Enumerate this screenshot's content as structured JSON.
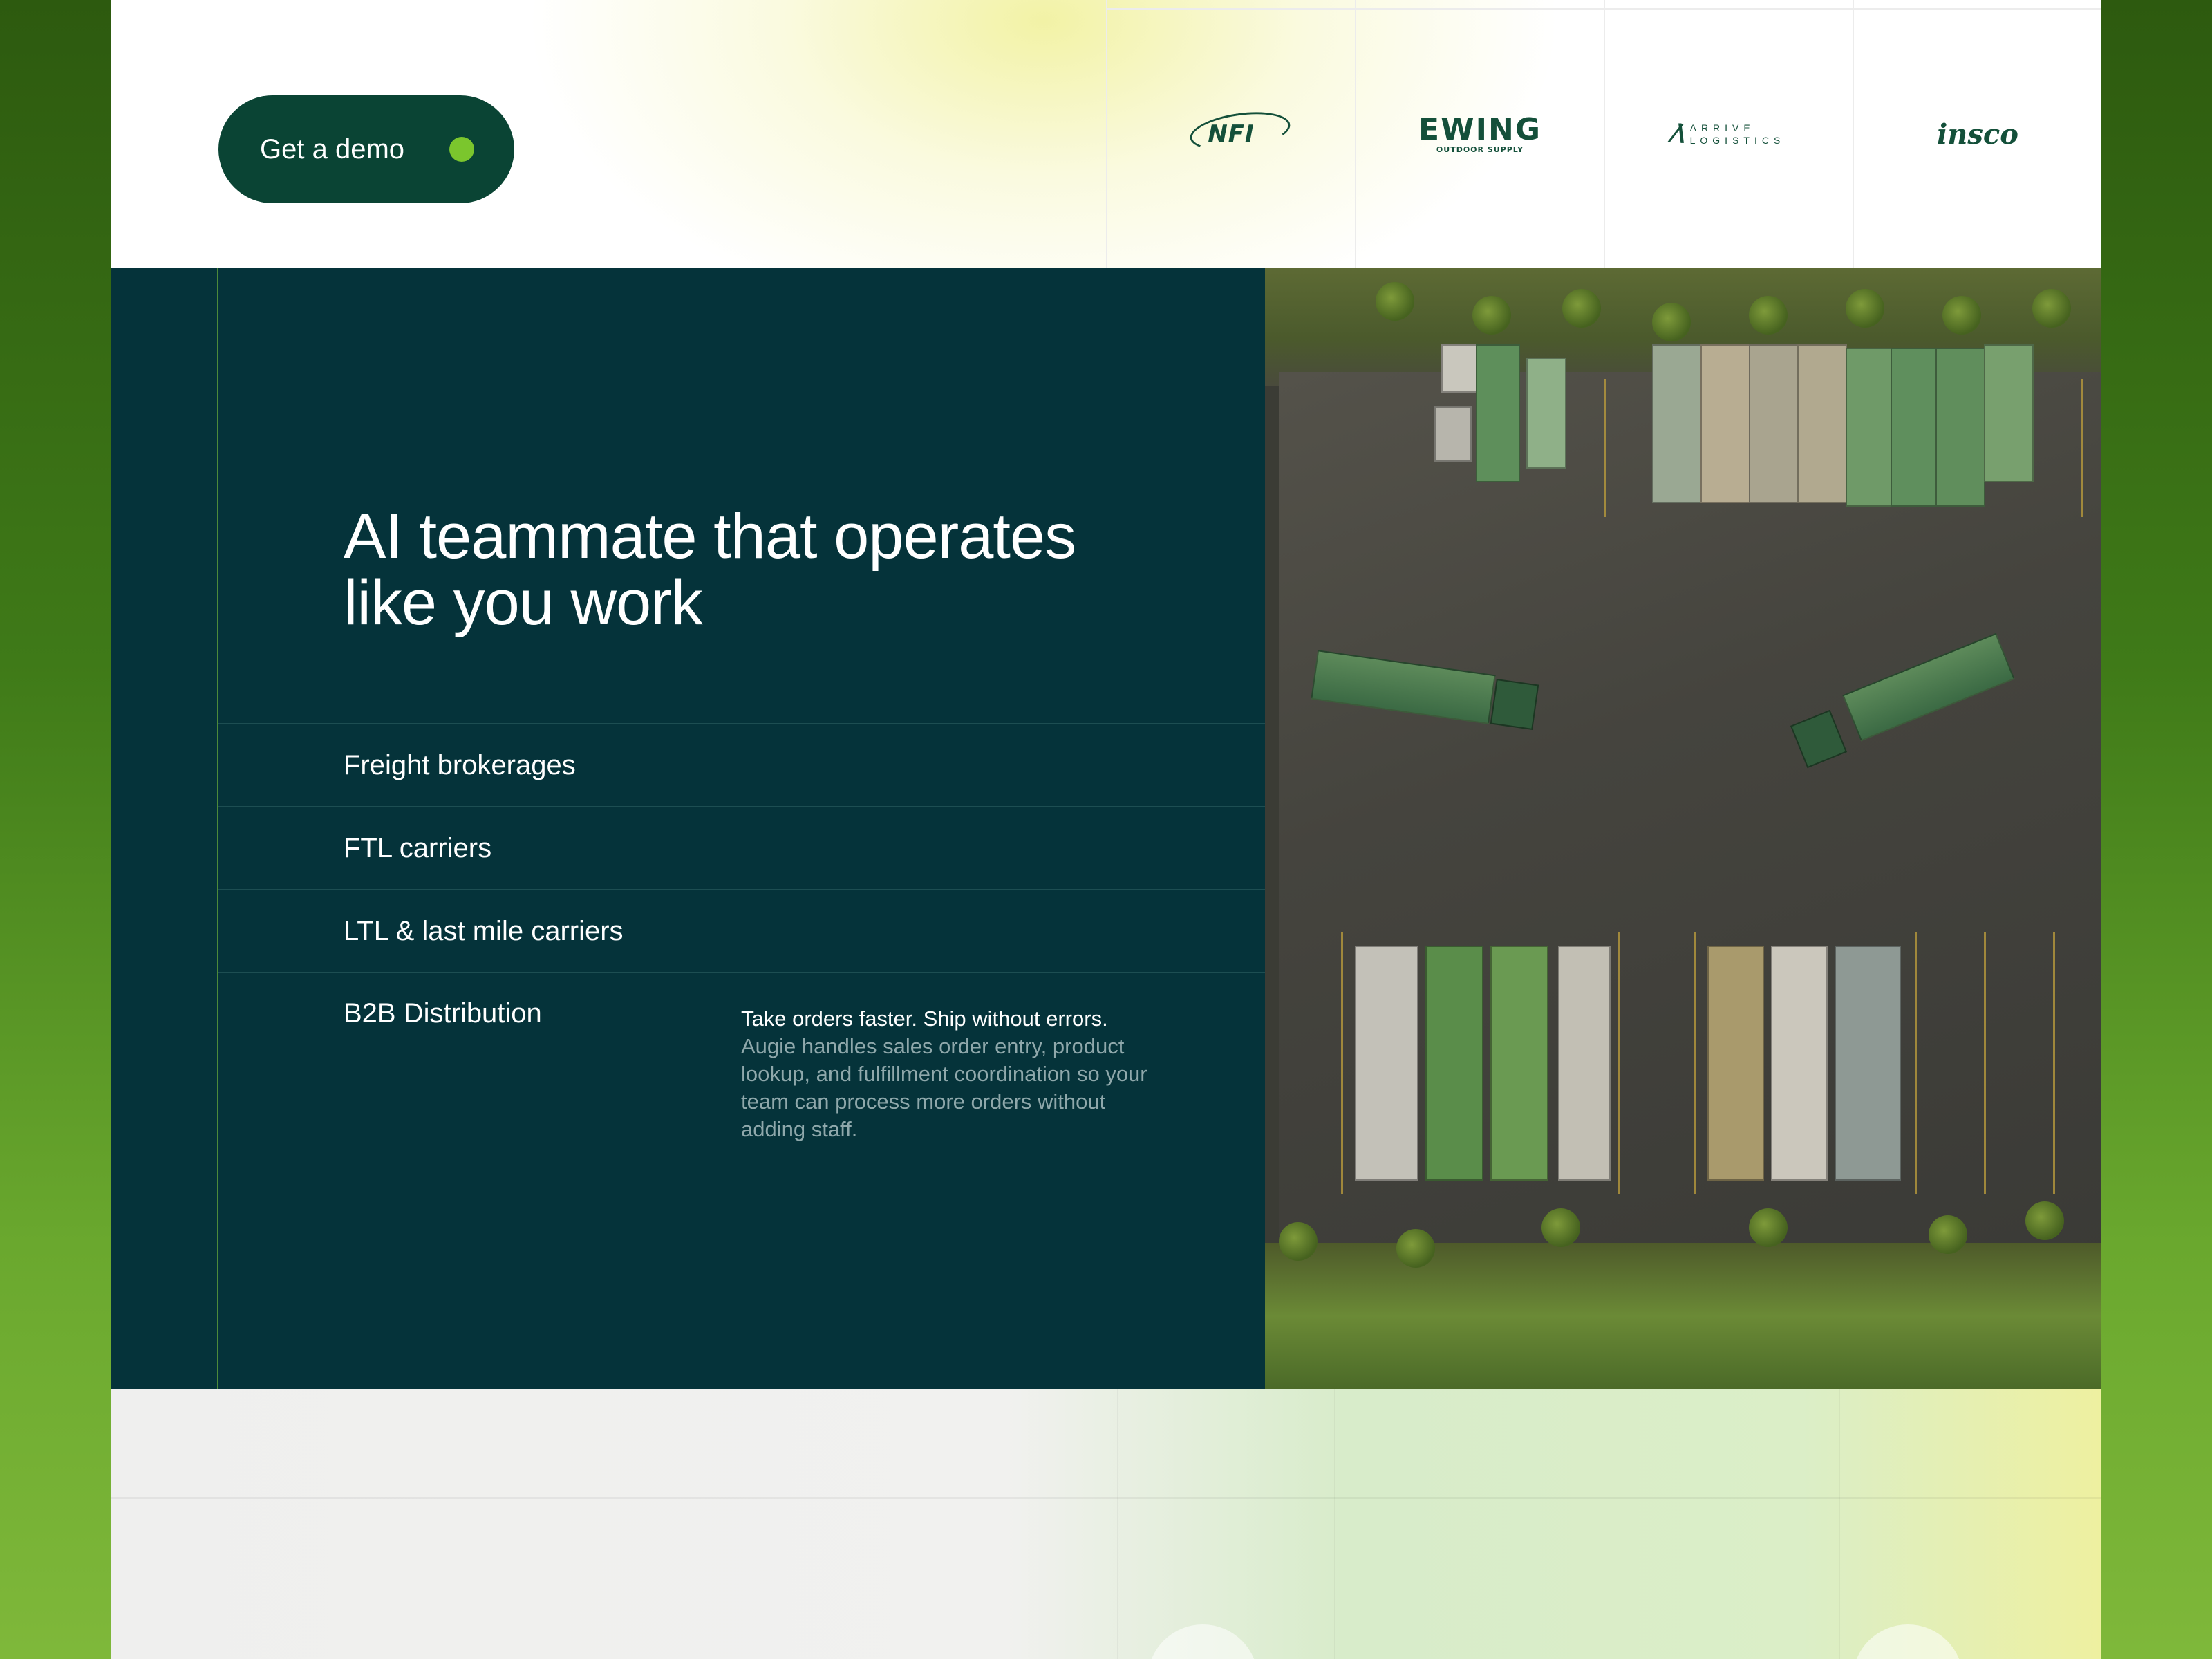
{
  "header": {
    "demo_button_label": "Get a demo",
    "logos": [
      {
        "name": "NFI",
        "text": "NFI"
      },
      {
        "name": "Ewing Outdoor Supply",
        "text": "EWING",
        "subtext": "OUTDOOR SUPPLY"
      },
      {
        "name": "Arrive Logistics",
        "text": "ARRIVE",
        "subtext": "LOGISTICS"
      },
      {
        "name": "Insco",
        "text": "insco"
      }
    ]
  },
  "hero": {
    "title_line1": "AI teammate that operates",
    "title_line2": "like you work",
    "segments": [
      {
        "label": "Freight brokerages"
      },
      {
        "label": "FTL carriers"
      },
      {
        "label": "LTL & last mile carriers"
      },
      {
        "label": "B2B Distribution"
      }
    ],
    "active_segment": {
      "lead": "Take orders faster. Ship without errors.",
      "body": "Augie handles sales order entry, product lookup, and fulfillment coordination so your team can process more orders without adding staff."
    },
    "image_alt": "Aerial view of trucks in a parking lot"
  },
  "colors": {
    "brand_dark": "#0a4434",
    "hero_bg": "#05333a",
    "accent_dot": "#7bc62d"
  }
}
